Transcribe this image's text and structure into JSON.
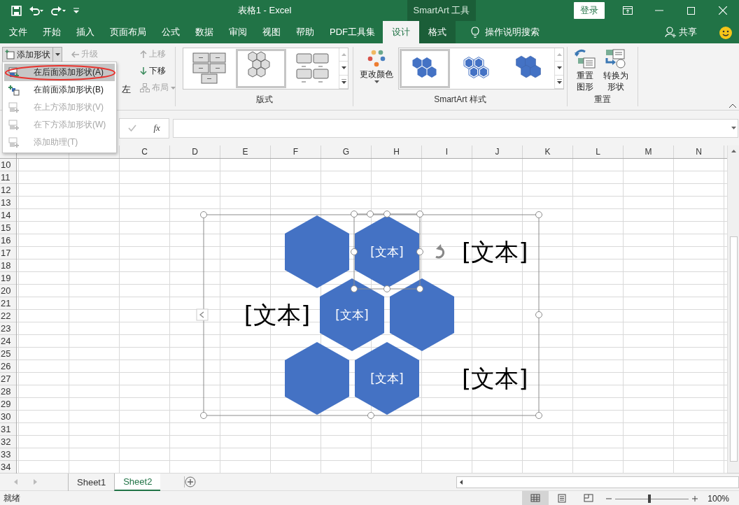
{
  "title_bar": {
    "title": "表格1  -  Excel",
    "context_label": "SmartArt 工具",
    "sign_in": "登录"
  },
  "menu_tabs": [
    {
      "label": "文件",
      "selected": false,
      "kind": "normal"
    },
    {
      "label": "开始",
      "selected": false,
      "kind": "normal"
    },
    {
      "label": "插入",
      "selected": false,
      "kind": "normal"
    },
    {
      "label": "页面布局",
      "selected": false,
      "kind": "normal"
    },
    {
      "label": "公式",
      "selected": false,
      "kind": "normal"
    },
    {
      "label": "数据",
      "selected": false,
      "kind": "normal"
    },
    {
      "label": "审阅",
      "selected": false,
      "kind": "normal"
    },
    {
      "label": "视图",
      "selected": false,
      "kind": "normal"
    },
    {
      "label": "帮助",
      "selected": false,
      "kind": "normal"
    },
    {
      "label": "PDF工具集",
      "selected": false,
      "kind": "normal"
    },
    {
      "label": "设计",
      "selected": true,
      "kind": "context"
    },
    {
      "label": "格式",
      "selected": false,
      "kind": "context"
    }
  ],
  "tell_me": "操作说明搜索",
  "share": "共享",
  "ribbon": {
    "create": {
      "add_shape": "添加形状",
      "promote": {
        "label": "升级",
        "disabled": true
      },
      "right_to_left_tail": "左",
      "move_up": {
        "label": "上移",
        "disabled": true
      },
      "move_down": {
        "label": "下移",
        "disabled": false
      },
      "layout": {
        "label": "布局",
        "disabled": true
      }
    },
    "layouts": {
      "label": "版式",
      "items": [
        {
          "kind": "grid",
          "selected": false
        },
        {
          "kind": "honeycomb",
          "selected": true
        },
        {
          "kind": "boxes",
          "selected": false
        }
      ]
    },
    "styles": {
      "change_colors": "更改颜色",
      "label": "SmartArt 样式",
      "items": [
        {
          "kind": "flat",
          "selected": true
        },
        {
          "kind": "outlined",
          "selected": false
        },
        {
          "kind": "joined",
          "selected": false
        }
      ]
    },
    "reset": {
      "label": "重置",
      "buttons": [
        {
          "kind": "reset",
          "lines": [
            "重置",
            "图形"
          ]
        },
        {
          "kind": "convert",
          "lines": [
            "转换为",
            "形状"
          ]
        }
      ]
    }
  },
  "add_shape_menu": [
    {
      "label": "在后面添加形状(A)",
      "disabled": false,
      "selected": true,
      "annotated": true
    },
    {
      "label": "在前面添加形状(B)",
      "disabled": false,
      "selected": false,
      "annotated": false
    },
    {
      "label": "在上方添加形状(V)",
      "disabled": true,
      "selected": false,
      "annotated": false
    },
    {
      "label": "在下方添加形状(W)",
      "disabled": true,
      "selected": false,
      "annotated": false
    },
    {
      "label": "添加助理(T)",
      "disabled": true,
      "selected": false,
      "annotated": false
    }
  ],
  "formula_bar": {
    "confirm_disabled": true,
    "function_label": "fx"
  },
  "sheet": {
    "columns": [
      "C",
      "D",
      "E",
      "F",
      "G",
      "H",
      "I",
      "J",
      "K",
      "L",
      "M",
      "N"
    ],
    "rows": [
      "10",
      "11",
      "12",
      "13",
      "14",
      "15",
      "16",
      "17",
      "18",
      "19",
      "20",
      "21",
      "22",
      "23",
      "24",
      "25",
      "26",
      "27",
      "28",
      "29",
      "30",
      "31",
      "32",
      "33",
      "34"
    ]
  },
  "smartart": {
    "shapes": [
      {
        "selected": false
      },
      {
        "text": "[文本]",
        "selected": true
      },
      {
        "text": "[文本]",
        "selected": false
      },
      {
        "selected": false
      },
      {
        "selected": false
      },
      {
        "text": "[文本]",
        "selected": false
      }
    ],
    "labels": [
      "[文本]",
      "[文本]",
      "[文本]"
    ]
  },
  "sheet_tabs": [
    {
      "label": "Sheet1",
      "selected": false
    },
    {
      "label": "Sheet2",
      "selected": true
    }
  ],
  "status_bar": {
    "status": "就绪",
    "views": [
      {
        "kind": "normal",
        "selected": true
      },
      {
        "kind": "page_layout",
        "selected": false
      },
      {
        "kind": "page_break",
        "selected": false
      }
    ],
    "zoom": {
      "level": 0.46
    },
    "zoom_text": "100%"
  }
}
